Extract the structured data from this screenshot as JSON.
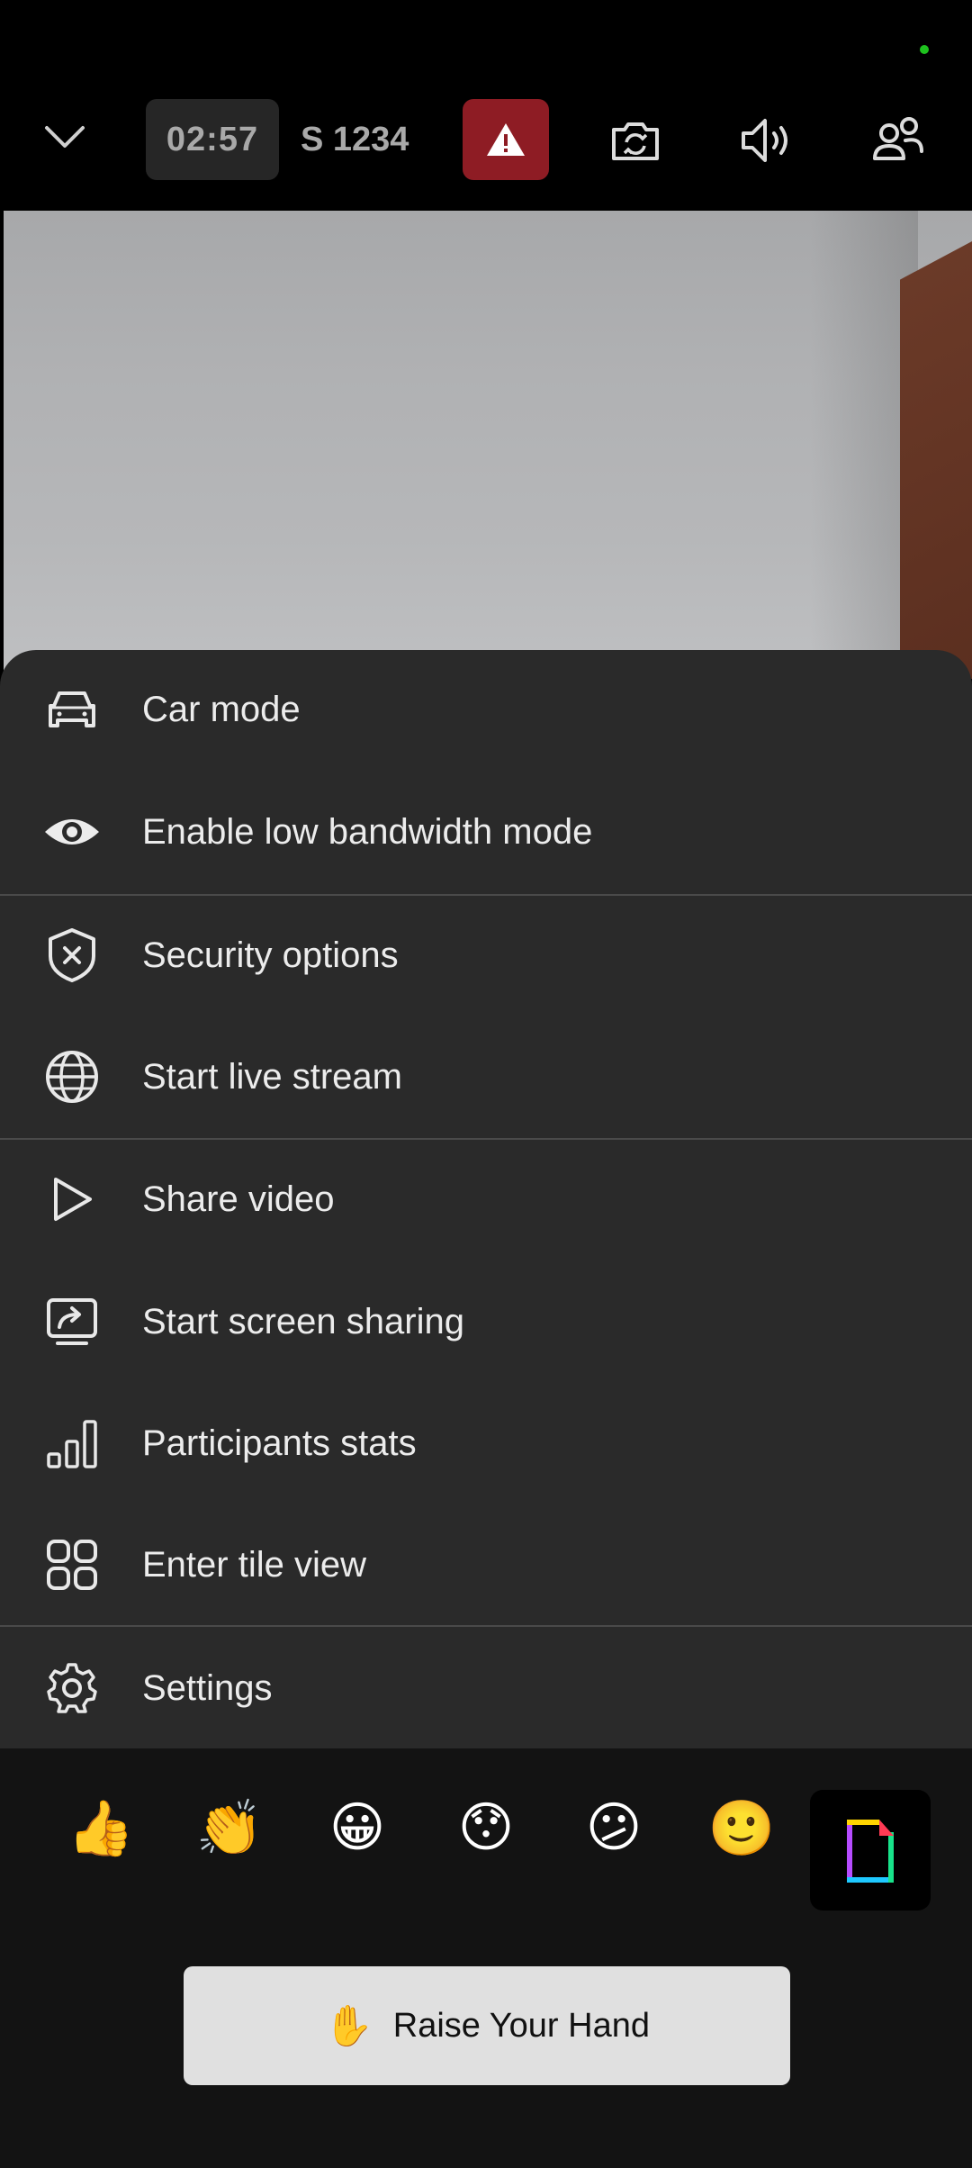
{
  "toolbar": {
    "timer": "02:57",
    "room_name": "S 1234"
  },
  "menu": {
    "items": [
      {
        "label": "Car mode",
        "icon": "car-icon"
      },
      {
        "label": "Enable low bandwidth mode",
        "icon": "eye-icon"
      },
      {
        "label": "Security options",
        "icon": "shield-icon"
      },
      {
        "label": "Start live stream",
        "icon": "globe-icon"
      },
      {
        "label": "Share video",
        "icon": "play-icon"
      },
      {
        "label": "Start screen sharing",
        "icon": "screen-share-icon"
      },
      {
        "label": "Participants stats",
        "icon": "bar-stats-icon"
      },
      {
        "label": "Enter tile view",
        "icon": "tile-grid-icon"
      },
      {
        "label": "Settings",
        "icon": "gear-icon"
      }
    ]
  },
  "reactions": {
    "emojis": [
      "👍",
      "👏",
      "😀",
      "😯",
      "😕",
      "🙂"
    ],
    "gif_button": "gif-icon"
  },
  "raise_hand": {
    "emoji": "✋",
    "label": "Raise Your Hand"
  },
  "colors": {
    "sheet_bg": "#2a2a2a",
    "alert_red": "#8e1c24",
    "status_green": "#1ec21e"
  }
}
